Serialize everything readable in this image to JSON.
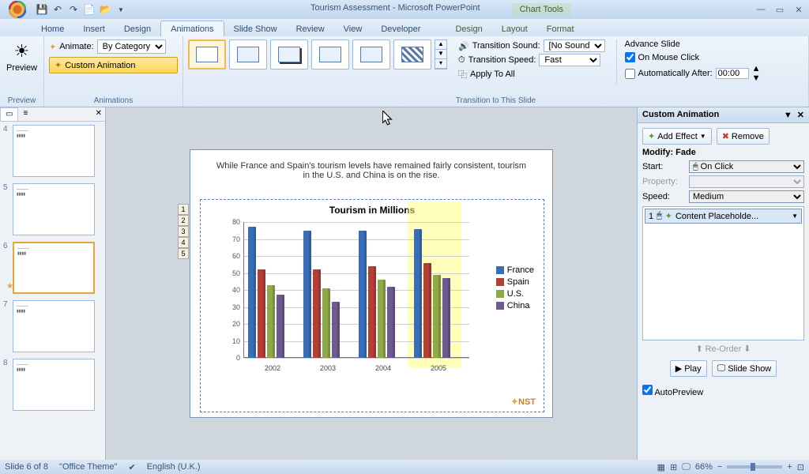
{
  "title": "Tourism Assessment - Microsoft PowerPoint",
  "chart_tools": "Chart Tools",
  "qat_icons": [
    "save",
    "undo",
    "redo",
    "new",
    "open"
  ],
  "tabs": [
    "Home",
    "Insert",
    "Design",
    "Animations",
    "Slide Show",
    "Review",
    "View",
    "Developer"
  ],
  "ctx_tabs": [
    "Design",
    "Layout",
    "Format"
  ],
  "active_tab": "Animations",
  "ribbon": {
    "preview_label": "Preview",
    "preview_group": "Preview",
    "animate_label": "Animate:",
    "animate_value": "By Category",
    "custom_animation": "Custom Animation",
    "animations_group": "Animations",
    "transition_sound": "Transition Sound:",
    "transition_sound_val": "[No Sound]",
    "transition_speed": "Transition Speed:",
    "transition_speed_val": "Fast",
    "apply_all": "Apply To All",
    "transition_group": "Transition to This Slide",
    "advance_slide": "Advance Slide",
    "on_mouse_click": "On Mouse Click",
    "auto_after": "Automatically After:",
    "auto_after_val": "00:00"
  },
  "thumbs": [
    {
      "n": "4"
    },
    {
      "n": "5"
    },
    {
      "n": "6",
      "sel": true
    },
    {
      "n": "7"
    },
    {
      "n": "8"
    }
  ],
  "slide_text": "While France and Spain's tourism levels have remained fairly consistent, tourism in the U.S. and China is on the rise.",
  "anim_tags": [
    "1",
    "2",
    "3",
    "4",
    "5"
  ],
  "chart_data": {
    "type": "bar",
    "title": "Tourism in Millions",
    "categories": [
      "2002",
      "2003",
      "2004",
      "2005"
    ],
    "ylim": [
      0,
      80
    ],
    "ytick": 10,
    "series": [
      {
        "name": "France",
        "color": "#3b6db5",
        "values": [
          77,
          75,
          75,
          76
        ]
      },
      {
        "name": "Spain",
        "color": "#b04038",
        "values": [
          52,
          52,
          54,
          56
        ]
      },
      {
        "name": "U.S.",
        "color": "#8fa94a",
        "values": [
          43,
          41,
          46,
          49
        ]
      },
      {
        "name": "China",
        "color": "#6d5a90",
        "values": [
          37,
          33,
          42,
          47
        ]
      }
    ]
  },
  "nst": "NST",
  "custom_pane": {
    "title": "Custom Animation",
    "add_effect": "Add Effect",
    "remove": "Remove",
    "modify": "Modify: Fade",
    "start_label": "Start:",
    "start_val": "On Click",
    "property_label": "Property:",
    "speed_label": "Speed:",
    "speed_val": "Medium",
    "effect_item": "Content Placeholde...",
    "effect_num": "1",
    "reorder": "Re-Order",
    "play": "Play",
    "slideshow": "Slide Show",
    "autopreview": "AutoPreview"
  },
  "status": {
    "slide": "Slide 6 of 8",
    "theme": "\"Office Theme\"",
    "lang": "English (U.K.)",
    "zoom": "66%"
  }
}
